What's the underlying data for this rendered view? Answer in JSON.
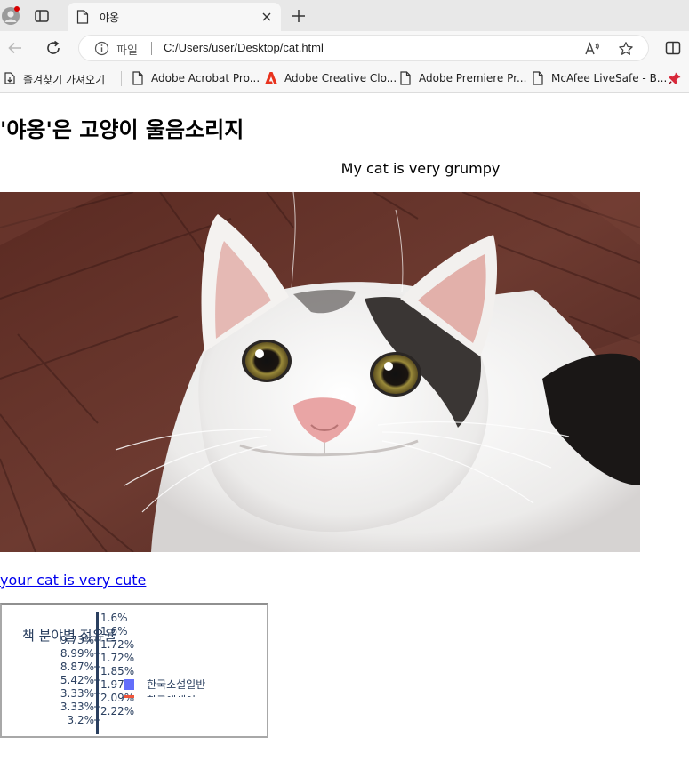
{
  "browser": {
    "tab_title": "야옹",
    "address_scheme": "파일",
    "url": "C:/Users/user/Desktop/cat.html",
    "bookmarks": [
      {
        "label": "즐겨찾기 가져오기",
        "icon": "import-icon"
      },
      {
        "label": "Adobe Acrobat Pro...",
        "icon": "page-icon"
      },
      {
        "label": "Adobe Creative Clo...",
        "icon": "adobe-icon"
      },
      {
        "label": "Adobe Premiere Pr...",
        "icon": "page-icon"
      },
      {
        "label": "McAfee LiveSafe - B...",
        "icon": "page-icon"
      }
    ],
    "colors": {
      "accent_red": "#d70000",
      "adobe_red": "#e8331e"
    }
  },
  "page": {
    "title": "'야옹'은 고양이 울음소리지",
    "caption": "My cat is very grumpy",
    "link_text": "your cat is very cute",
    "link_color": "#0000ee"
  },
  "chart_data": {
    "type": "pie",
    "title": "책 분야별 점유율",
    "legend_entries": [
      "한국소설일반",
      "한국에세이"
    ],
    "left_labels": [
      "9.73%",
      "8.99%",
      "8.87%",
      "5.42%",
      "3.33%",
      "3.33%",
      "3.2%"
    ],
    "right_labels": [
      "1.6%",
      "1.6%",
      "1.72%",
      "1.72%",
      "1.85%",
      "1.97%",
      "2.09%",
      "2.22%"
    ],
    "colors": [
      "#636efa",
      "#ef553b"
    ]
  }
}
